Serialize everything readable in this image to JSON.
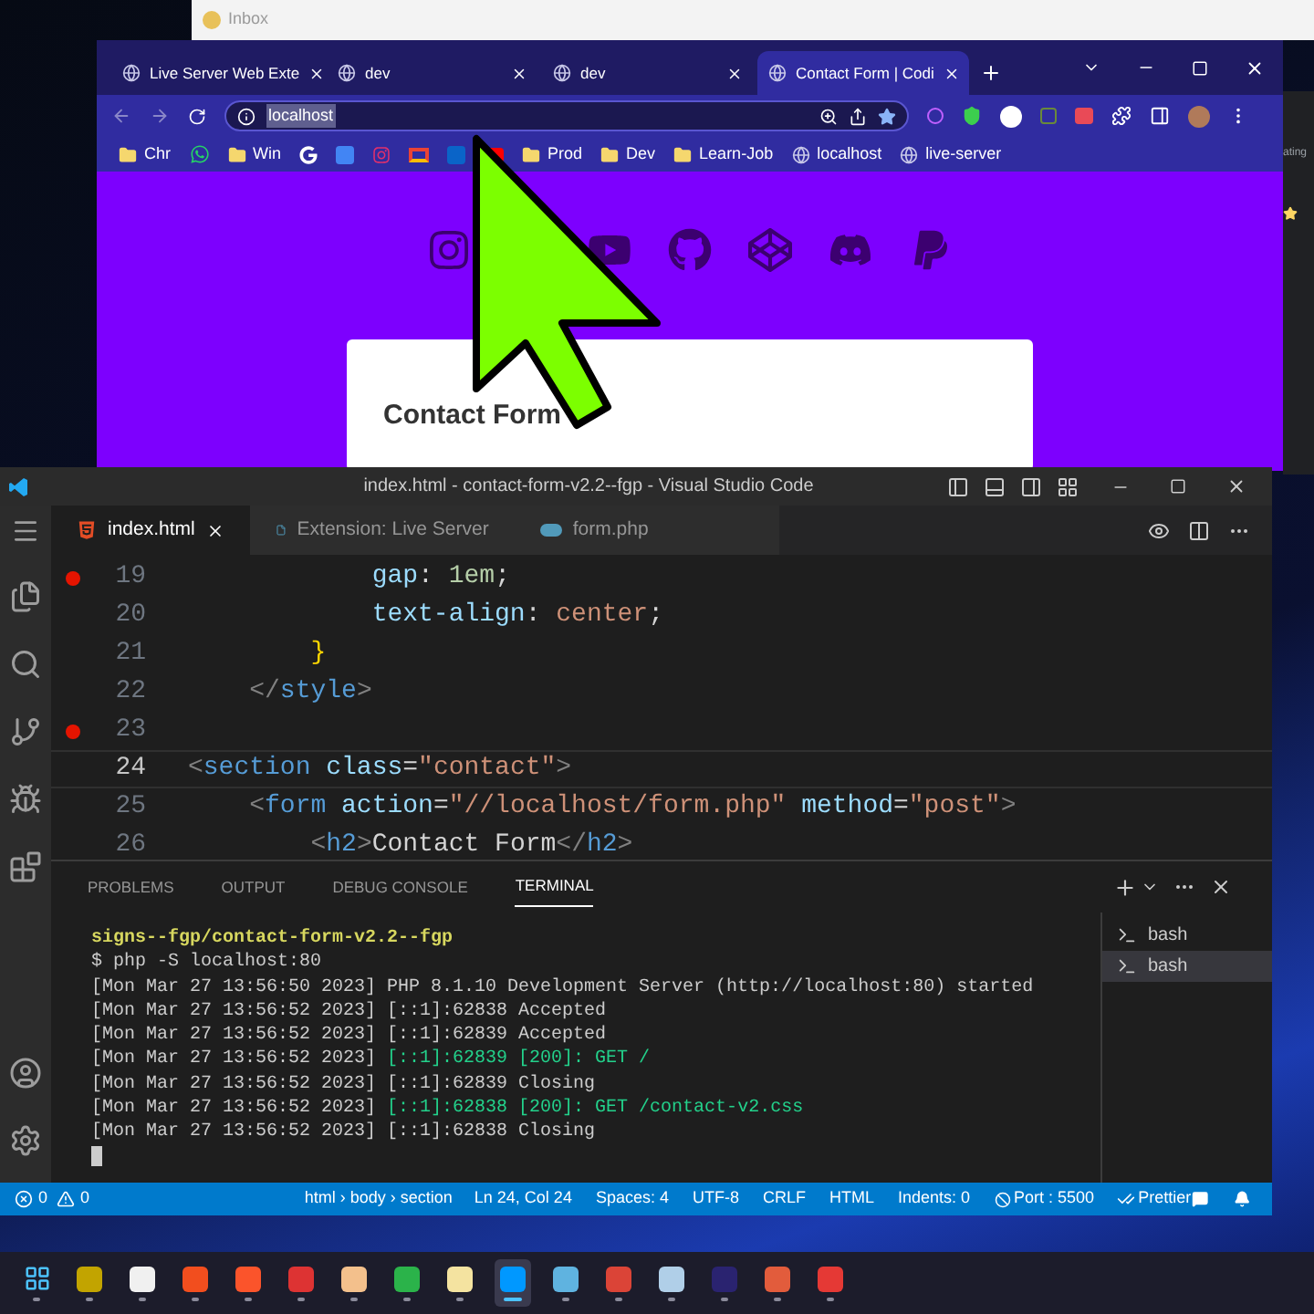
{
  "inbox_window": {
    "title": "Inbox"
  },
  "browser": {
    "tabs": [
      {
        "title": "Live Server Web Exte",
        "selected": false
      },
      {
        "title": "dev",
        "selected": false
      },
      {
        "title": "dev",
        "selected": false
      },
      {
        "title": "Contact Form | Codi",
        "selected": true
      }
    ],
    "address": "localhost",
    "bookmarks": [
      {
        "kind": "folder",
        "label": "Chr"
      },
      {
        "kind": "whatsapp"
      },
      {
        "kind": "folder",
        "label": "Win"
      },
      {
        "kind": "google"
      },
      {
        "kind": "translate"
      },
      {
        "kind": "instagram"
      },
      {
        "kind": "gmail"
      },
      {
        "kind": "outlook"
      },
      {
        "kind": "youtube"
      },
      {
        "kind": "folder",
        "label": "Prod"
      },
      {
        "kind": "folder",
        "label": "Dev"
      },
      {
        "kind": "folder",
        "label": "Learn-Job"
      },
      {
        "kind": "site",
        "label": "localhost"
      },
      {
        "kind": "site",
        "label": "live-server"
      }
    ],
    "page": {
      "form_title": "Contact Form"
    }
  },
  "side_window": {
    "text": "ating"
  },
  "vscode": {
    "title": "index.html - contact-form-v2.2--fgp - Visual Studio Code",
    "tabs": [
      {
        "label": "index.html",
        "kind": "html",
        "selected": true
      },
      {
        "label": "Extension: Live Server",
        "kind": "file",
        "selected": false
      },
      {
        "label": "form.php",
        "kind": "php",
        "selected": false
      }
    ],
    "lines": [
      {
        "number": "19",
        "breakpoint": true,
        "current": false,
        "tokens": [
          {
            "text": "            gap",
            "kind": "prop"
          },
          {
            "text": ": ",
            "kind": "text"
          },
          {
            "text": "1em",
            "kind": "number"
          },
          {
            "text": ";",
            "kind": "text"
          }
        ]
      },
      {
        "number": "20",
        "breakpoint": false,
        "current": false,
        "tokens": [
          {
            "text": "            text-align",
            "kind": "prop"
          },
          {
            "text": ": ",
            "kind": "text"
          },
          {
            "text": "center",
            "kind": "value"
          },
          {
            "text": ";",
            "kind": "text"
          }
        ]
      },
      {
        "number": "21",
        "breakpoint": false,
        "current": false,
        "tokens": [
          {
            "text": "        }",
            "kind": "brace"
          }
        ]
      },
      {
        "number": "22",
        "breakpoint": false,
        "current": false,
        "tokens": [
          {
            "text": "    </",
            "kind": "punct"
          },
          {
            "text": "style",
            "kind": "tag"
          },
          {
            "text": ">",
            "kind": "punct"
          }
        ]
      },
      {
        "number": "23",
        "breakpoint": true,
        "current": false
      },
      {
        "number": "24",
        "breakpoint": false,
        "current": true,
        "tokens": [
          {
            "text": "<",
            "kind": "punct"
          },
          {
            "text": "section",
            "kind": "tag"
          },
          {
            "text": " class",
            "kind": "attr"
          },
          {
            "text": "=",
            "kind": "text"
          },
          {
            "text": "\"contact\"",
            "kind": "value"
          },
          {
            "text": ">",
            "kind": "punct"
          }
        ]
      },
      {
        "number": "25",
        "breakpoint": false,
        "current": false,
        "tokens": [
          {
            "text": "    <",
            "kind": "punct"
          },
          {
            "text": "form",
            "kind": "tag"
          },
          {
            "text": " action",
            "kind": "attr"
          },
          {
            "text": "=",
            "kind": "text"
          },
          {
            "text": "\"//localhost/form.php\"",
            "kind": "value"
          },
          {
            "text": " method",
            "kind": "attr"
          },
          {
            "text": "=",
            "kind": "text"
          },
          {
            "text": "\"post\"",
            "kind": "value"
          },
          {
            "text": ">",
            "kind": "punct"
          }
        ]
      },
      {
        "number": "26",
        "breakpoint": false,
        "current": false,
        "tokens": [
          {
            "text": "        <",
            "kind": "punct"
          },
          {
            "text": "h2",
            "kind": "tag"
          },
          {
            "text": ">",
            "kind": "punct"
          },
          {
            "text": "Contact Form",
            "kind": "text"
          },
          {
            "text": "</",
            "kind": "punct"
          },
          {
            "text": "h2",
            "kind": "tag"
          },
          {
            "text": ">",
            "kind": "punct"
          }
        ]
      }
    ],
    "panel_tabs": [
      {
        "label": "PROBLEMS",
        "selected": false
      },
      {
        "label": "OUTPUT",
        "selected": false
      },
      {
        "label": "DEBUG CONSOLE",
        "selected": false
      },
      {
        "label": "TERMINAL",
        "selected": true
      }
    ],
    "terminal": [
      {
        "kind": "plain",
        "segments": [
          {
            "text": "signs--fgp/contact-form-v2.2--fgp",
            "kind": "prompt"
          }
        ]
      },
      {
        "kind": "plain",
        "segments": [
          {
            "text": "$ php -S localhost:80",
            "kind": "normal"
          }
        ]
      },
      {
        "kind": "plain",
        "segments": [
          {
            "text": "[Mon Mar 27 13:56:50 2023] PHP 8.1.10 Development Server (http://localhost:80) started",
            "kind": "normal"
          }
        ]
      },
      {
        "kind": "plain",
        "segments": [
          {
            "text": "[Mon Mar 27 13:56:52 2023] [::1]:62838 Accepted",
            "kind": "normal"
          }
        ]
      },
      {
        "kind": "plain",
        "segments": [
          {
            "text": "[Mon Mar 27 13:56:52 2023] [::1]:62839 Accepted",
            "kind": "normal"
          }
        ]
      },
      {
        "kind": "plain",
        "segments": [
          {
            "text": "[Mon Mar 27 13:56:52 2023] ",
            "kind": "normal"
          },
          {
            "text": "[::1]:62839 [200]: GET /",
            "kind": "green"
          }
        ]
      },
      {
        "kind": "plain",
        "segments": [
          {
            "text": "[Mon Mar 27 13:56:52 2023] [::1]:62839 Closing",
            "kind": "normal"
          }
        ]
      },
      {
        "kind": "plain",
        "segments": [
          {
            "text": "[Mon Mar 27 13:56:52 2023] ",
            "kind": "normal"
          },
          {
            "text": "[::1]:62838 [200]: GET /contact-v2.css",
            "kind": "green"
          }
        ]
      },
      {
        "kind": "plain",
        "segments": [
          {
            "text": "[Mon Mar 27 13:56:52 2023] [::1]:62838 Closing",
            "kind": "normal"
          }
        ]
      }
    ],
    "terminals": [
      {
        "label": "bash",
        "selected": false
      },
      {
        "label": "bash",
        "selected": true
      }
    ],
    "status": {
      "errors": "0",
      "warnings": "0",
      "breadcrumb": "html › body › section",
      "items": [
        "Ln 24, Col 24",
        "Spaces: 4",
        "UTF-8",
        "CRLF",
        "HTML",
        "Indents: 0"
      ],
      "port": "Port : 5500",
      "formatter": "Prettier"
    }
  },
  "taskbar": [
    {
      "kind": "start",
      "selected": false
    },
    {
      "kind": "app",
      "selected": false
    },
    {
      "kind": "app",
      "selected": false
    },
    {
      "kind": "app",
      "selected": false
    },
    {
      "kind": "app",
      "selected": false
    },
    {
      "kind": "app",
      "selected": false
    },
    {
      "kind": "app",
      "selected": false
    },
    {
      "kind": "app",
      "selected": false
    },
    {
      "kind": "app",
      "selected": false
    },
    {
      "kind": "app",
      "selected": true
    },
    {
      "kind": "app",
      "selected": false
    },
    {
      "kind": "app",
      "selected": false
    },
    {
      "kind": "app",
      "selected": false
    },
    {
      "kind": "app",
      "selected": false
    },
    {
      "kind": "app",
      "selected": false
    },
    {
      "kind": "app",
      "selected": false
    }
  ]
}
